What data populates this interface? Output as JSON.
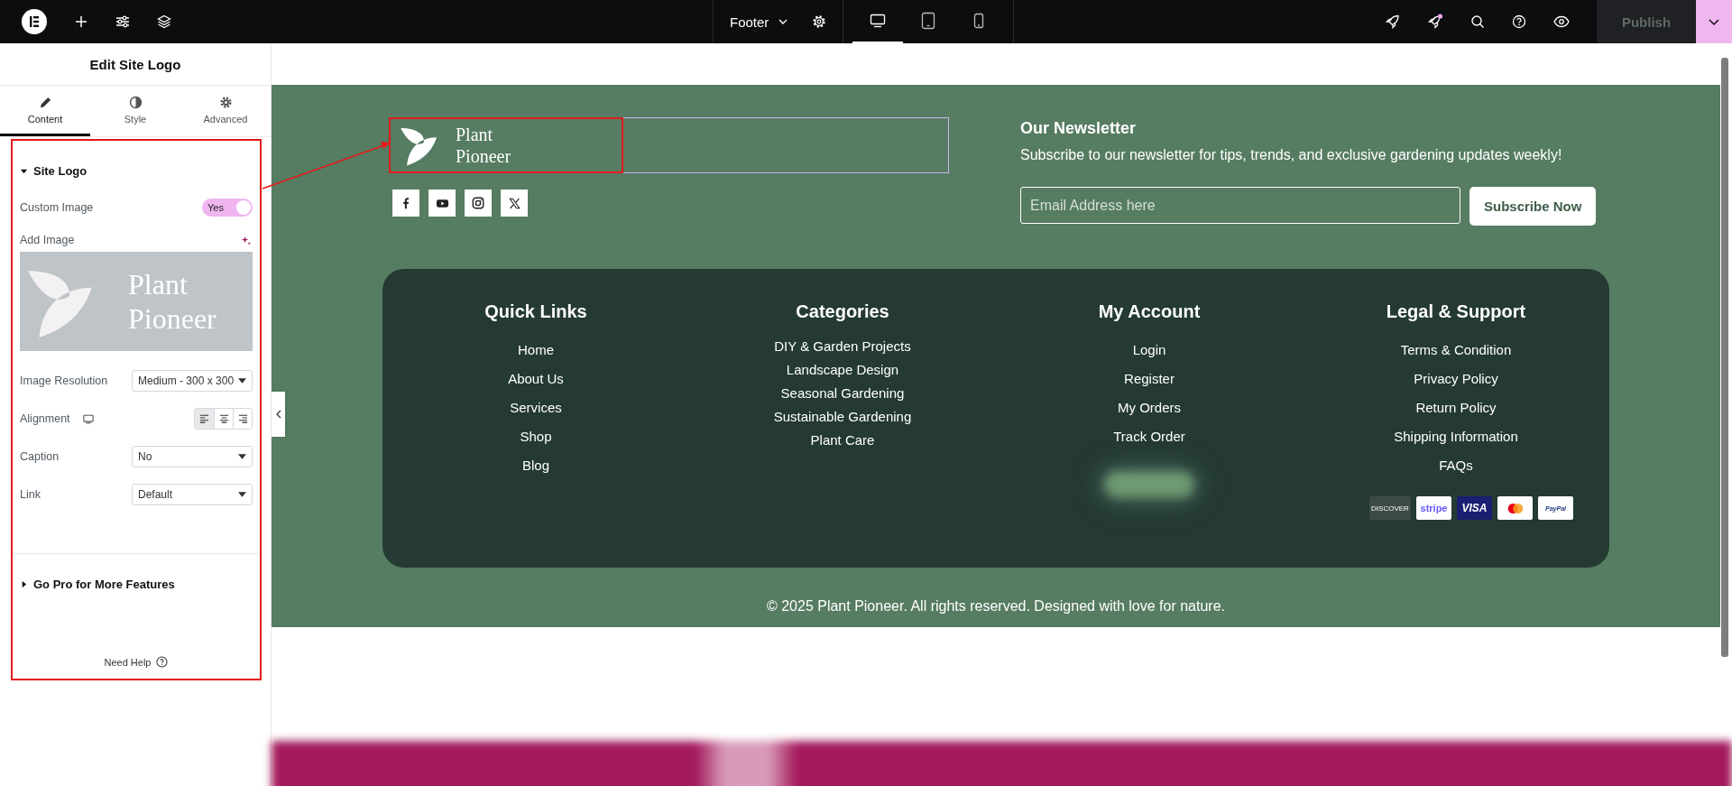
{
  "topbar": {
    "document": "Footer",
    "devices": [
      {
        "kind": "desktop",
        "selected": true
      },
      {
        "kind": "tablet",
        "selected": false
      },
      {
        "kind": "mobile",
        "selected": false
      }
    ],
    "notification_dot": true,
    "publish": {
      "label": "Publish",
      "disabled": true
    }
  },
  "panel": {
    "title": "Edit Site Logo",
    "tabs": [
      {
        "kind": "content",
        "label": "Content",
        "selected": true
      },
      {
        "kind": "style",
        "label": "Style",
        "selected": false
      },
      {
        "kind": "advanced",
        "label": "Advanced",
        "selected": false
      }
    ],
    "section": {
      "title": "Site Logo",
      "expanded": true
    },
    "custom_image": {
      "label": "Custom Image",
      "on": true,
      "value": "Yes"
    },
    "add_image": {
      "label": "Add Image",
      "preview_lines": [
        "Plant",
        "Pioneer"
      ]
    },
    "selects": [
      {
        "label": "Image Resolution",
        "value": "Medium - 300 x 300"
      }
    ],
    "alignment": {
      "label": "Alignment",
      "options": [
        {
          "kind": "left",
          "selected": true
        },
        {
          "kind": "center",
          "selected": false
        },
        {
          "kind": "right",
          "selected": false
        }
      ]
    },
    "selects_after": [
      {
        "label": "Caption",
        "value": "No"
      },
      {
        "label": "Link",
        "value": "Default"
      }
    ],
    "pro_section": {
      "title": "Go Pro for More Features",
      "expanded": false
    },
    "help": "Need Help"
  },
  "footer": {
    "logo_lines": [
      "Plant",
      "Pioneer"
    ],
    "socials": [
      {
        "kind": "facebook"
      },
      {
        "kind": "youtube"
      },
      {
        "kind": "instagram"
      },
      {
        "kind": "x"
      }
    ],
    "newsletter": {
      "title": "Our Newsletter",
      "text": "Subscribe to our newsletter for tips, trends, and exclusive gardening updates weekly!",
      "placeholder": "Email Address here",
      "button": "Subscribe Now"
    },
    "columns": [
      {
        "title": "Quick Links",
        "links": [
          "Home",
          "About Us",
          "Services",
          "Shop",
          "Blog"
        ]
      },
      {
        "title": "Categories",
        "links": [
          "DIY & Garden Projects",
          "Landscape Design",
          "Seasonal Gardening",
          "Sustainable Gardening",
          "Plant Care"
        ]
      },
      {
        "title": "My Account",
        "links": [
          "Login",
          "Register",
          "My Orders",
          "Track Order"
        ]
      },
      {
        "title": "Legal & Support",
        "links": [
          "Terms & Condition",
          "Privacy Policy",
          "Return Policy",
          "Shipping Information",
          "FAQs"
        ]
      }
    ],
    "payments": [
      {
        "kind": "discover",
        "label": "DISCOVER"
      },
      {
        "kind": "stripe",
        "label": "stripe"
      },
      {
        "kind": "visa",
        "label": "VISA"
      },
      {
        "kind": "mastercard"
      },
      {
        "kind": "paypal",
        "label": "PayPal"
      }
    ],
    "copyright": "© 2025 Plant Pioneer. All rights reserved. Designed with love for nature."
  }
}
